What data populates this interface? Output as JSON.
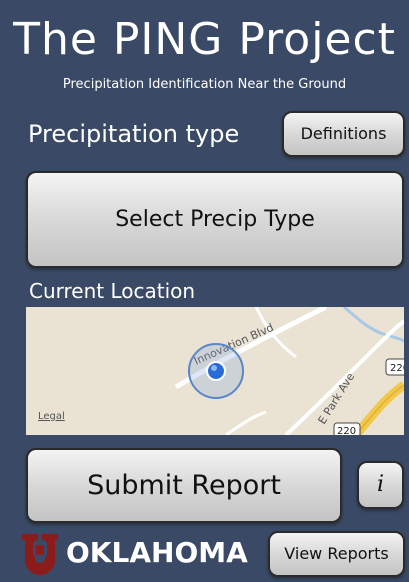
{
  "app": {
    "title": "The PING Project",
    "subtitle": "Precipitation Identification Near the Ground"
  },
  "precip": {
    "label": "Precipitation type",
    "definitions_label": "Definitions",
    "select_label": "Select Precip Type"
  },
  "location": {
    "label": "Current Location",
    "map": {
      "roads": [
        "Innovation Blvd",
        "E Park Ave"
      ],
      "route_shields": [
        "220",
        "220"
      ],
      "legal_label": "Legal",
      "colors": {
        "land": "#eae3d4",
        "water": "#a8c8e8",
        "highway": "#f2c84b",
        "location_dot": "#2a6cd6"
      }
    }
  },
  "actions": {
    "submit_label": "Submit Report",
    "info_label": "i",
    "view_reports_label": "View Reports"
  },
  "brand": {
    "name": "OKLAHOMA",
    "logo_color": "#8a1c1c"
  },
  "colors": {
    "background": "#3a4a66",
    "button": "#d8d8d8",
    "text_light": "#ffffff"
  }
}
